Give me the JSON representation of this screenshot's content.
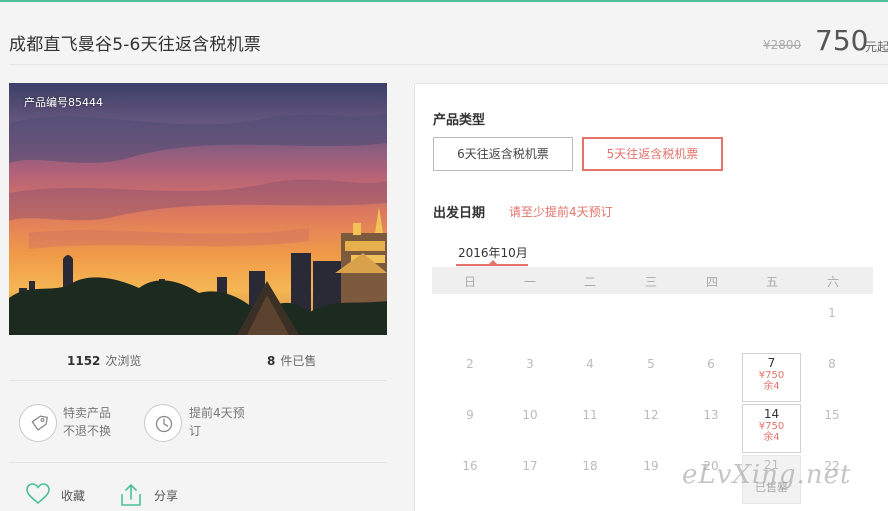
{
  "header": {
    "title": "成都直飞曼谷5-6天往返含税机票",
    "original_price": "¥2800",
    "price": "750",
    "price_unit": "元起"
  },
  "hero": {
    "product_code": "产品编号85444"
  },
  "stats": {
    "views_count": "1152",
    "views_label": "次浏览",
    "sold_count": "8",
    "sold_label": "件已售"
  },
  "features": {
    "special_line1": "特卖产品",
    "special_line2": "不退不换",
    "advance_line1": "提前4天预",
    "advance_line2": "订"
  },
  "actions": {
    "favorite": "收藏",
    "share": "分享"
  },
  "booking": {
    "type_label": "产品类型",
    "options": [
      "6天往返含税机票",
      "5天往返含税机票"
    ],
    "date_label": "出发日期",
    "notice": "请至少提前4天预订",
    "month": "2016年10月",
    "weekdays": [
      "日",
      "一",
      "二",
      "三",
      "四",
      "五",
      "六"
    ],
    "days": {
      "d1": "1",
      "d2": "2",
      "d3": "3",
      "d4": "4",
      "d5": "5",
      "d6": "6",
      "d8": "8",
      "d9": "9",
      "d10": "10",
      "d11": "11",
      "d12": "12",
      "d13": "13",
      "d15": "15",
      "d16": "16",
      "d17": "17",
      "d18": "18",
      "d19": "19",
      "d20": "20",
      "d22": "22"
    },
    "available": [
      {
        "day": "7",
        "price": "¥750",
        "remain": "余4"
      },
      {
        "day": "14",
        "price": "¥750",
        "remain": "余4"
      }
    ],
    "soldout": {
      "day": "21",
      "label": "已售罄"
    }
  },
  "watermark": "eLvXing.net",
  "colors": {
    "accent": "#e4736b",
    "green": "#4cbf9a"
  }
}
